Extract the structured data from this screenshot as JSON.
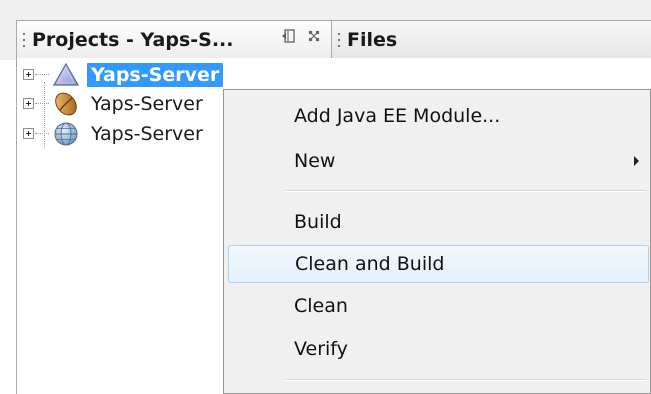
{
  "tabs": [
    {
      "label": "Projects - Yaps-S...",
      "active": true
    },
    {
      "label": "Files",
      "active": false
    }
  ],
  "tab_controls": [
    "minimize-window-icon",
    "close-icon"
  ],
  "tree": {
    "nodes": [
      {
        "label": "Yaps-Server",
        "icon": "ear-project-icon",
        "selected": true
      },
      {
        "label": "Yaps-Server",
        "icon": "ejb-bean-icon",
        "selected": false
      },
      {
        "label": "Yaps-Server",
        "icon": "web-globe-icon",
        "selected": false
      }
    ]
  },
  "context_menu": {
    "items": [
      {
        "label": "Add Java EE Module..."
      },
      {
        "label": "New",
        "has_submenu": true
      },
      {
        "label": "Build"
      },
      {
        "label": "Clean and Build",
        "highlighted": true
      },
      {
        "label": "Clean"
      },
      {
        "label": "Verify"
      }
    ]
  },
  "colors": {
    "selection": "#3399ff",
    "menu_hover_border": "#aed0ef",
    "menu_background": "#f0f0f0"
  }
}
